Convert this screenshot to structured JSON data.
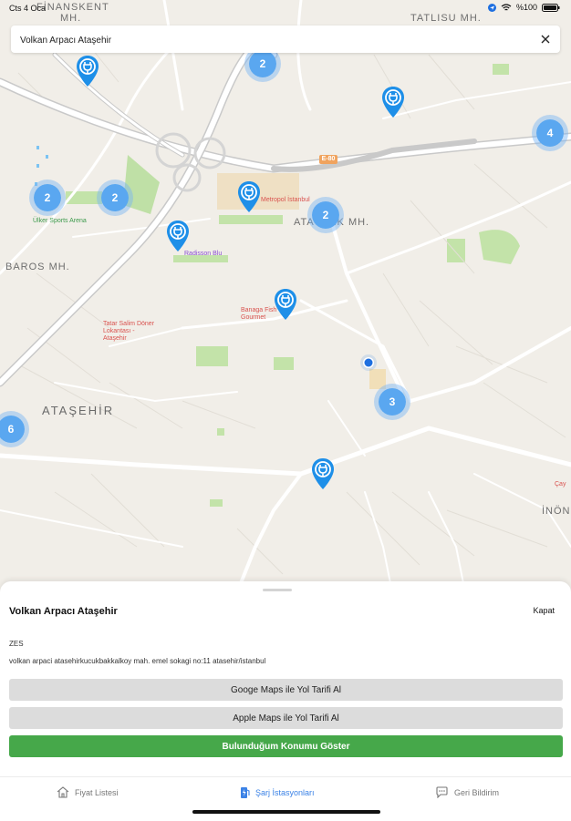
{
  "status_bar": {
    "time": "Cts 4 Oca",
    "battery": "%100"
  },
  "search": {
    "value": "Volkan Arpacı Ataşehir"
  },
  "map": {
    "districts": [
      "FİNANSKENT",
      "TATLISU MH.",
      "ATATÜRK MH.",
      "BAROS MH.",
      "ATAŞEHİR",
      "İNÖNÜ MH.",
      "MH."
    ],
    "pois": {
      "ulker": "Ülker Sports Arena",
      "metropol": "Metropol İstanbul",
      "radisson": "Radisson Blu",
      "banaga": "Banaga Fish Gourmet",
      "tatar": "Tatar Salim Döner Lokantası - Ataşehir",
      "cay": "Çay"
    },
    "road_shield": "E-80",
    "clusters": [
      "2",
      "4",
      "2",
      "2",
      "2",
      "3",
      "6"
    ]
  },
  "sheet": {
    "title": "Volkan Arpacı Ataşehir",
    "close_label": "Kapat",
    "operator": "ZES",
    "address": "volkan arpaci atasehirkucukbakkalkoy mah. emel sokagi no:11 atasehir/istanbul",
    "google_btn": "Googe Maps ile Yol Tarifi Al",
    "apple_btn": "Apple Maps ile Yol Tarifi Al",
    "location_btn": "Bulunduğum Konumu Göster"
  },
  "tabs": [
    {
      "label": "Fiyat Listesi",
      "icon": "home-icon"
    },
    {
      "label": "Şarj İstasyonları",
      "icon": "charging-station-icon"
    },
    {
      "label": "Geri Bildirim",
      "icon": "chat-bubble-icon"
    }
  ],
  "colors": {
    "accent": "#3b82e6",
    "green": "#46a84a",
    "pin": "#1e8fe8",
    "cluster": "#5aa7f0"
  }
}
